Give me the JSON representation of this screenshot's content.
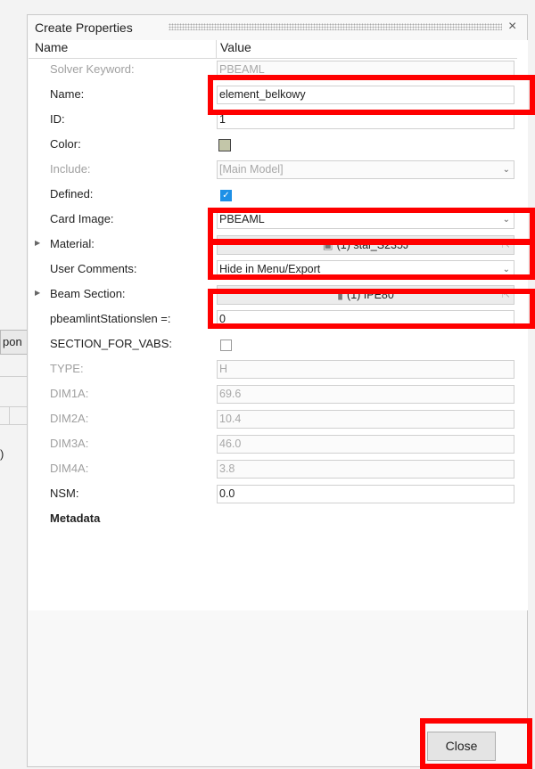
{
  "background": {
    "button_fragment": "pon",
    "text_fragment": ")"
  },
  "dialog": {
    "title": "Create Properties",
    "close_glyph": "×",
    "columns": {
      "name": "Name",
      "value": "Value"
    },
    "rows": {
      "solver_keyword": {
        "label": "Solver Keyword:",
        "value": "PBEAML"
      },
      "name": {
        "label": "Name:",
        "value": "element_belkowy"
      },
      "id": {
        "label": "ID:",
        "value": "1"
      },
      "color": {
        "label": "Color:",
        "swatch_color": "#c3c6a9"
      },
      "include": {
        "label": "Include:",
        "value": "[Main Model]"
      },
      "defined": {
        "label": "Defined:",
        "checked": true
      },
      "card_image": {
        "label": "Card Image:",
        "value": "PBEAML"
      },
      "material": {
        "label": "Material:",
        "value": "(1) stal_S235J"
      },
      "user_comments": {
        "label": "User Comments:",
        "value": "Hide in Menu/Export"
      },
      "beam_section": {
        "label": "Beam Section:",
        "value": "(1) IPE80"
      },
      "pbeaml_stations": {
        "label": "pbeamlintStationslen =:",
        "value": "0"
      },
      "section_for_vabs": {
        "label": "SECTION_FOR_VABS:",
        "checked": false
      },
      "type": {
        "label": "TYPE:",
        "value": "H"
      },
      "dim1a": {
        "label": "DIM1A:",
        "value": "69.6"
      },
      "dim2a": {
        "label": "DIM2A:",
        "value": "10.4"
      },
      "dim3a": {
        "label": "DIM3A:",
        "value": "46.0"
      },
      "dim4a": {
        "label": "DIM4A:",
        "value": "3.8"
      },
      "nsm": {
        "label": "NSM:",
        "value": "0.0"
      },
      "metadata": {
        "label": "Metadata"
      }
    },
    "close_button": "Close"
  },
  "annotation_color": "#ff0000"
}
